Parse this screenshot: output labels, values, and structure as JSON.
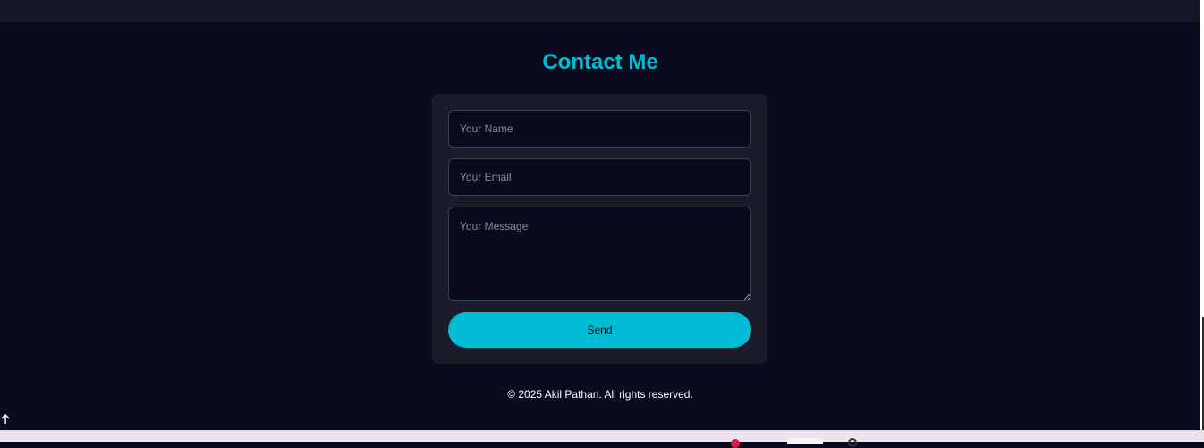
{
  "contact": {
    "title": "Contact Me",
    "name_placeholder": "Your Name",
    "email_placeholder": "Your Email",
    "message_placeholder": "Your Message",
    "send_label": "Send"
  },
  "footer": {
    "text": "© 2025 Akil Pathan. All rights reserved."
  },
  "icons": {
    "scroll_top": "arrow-up-icon"
  },
  "colors": {
    "accent": "#00bcd4",
    "background": "#0a0b1e",
    "card": "#1b1c2a"
  }
}
